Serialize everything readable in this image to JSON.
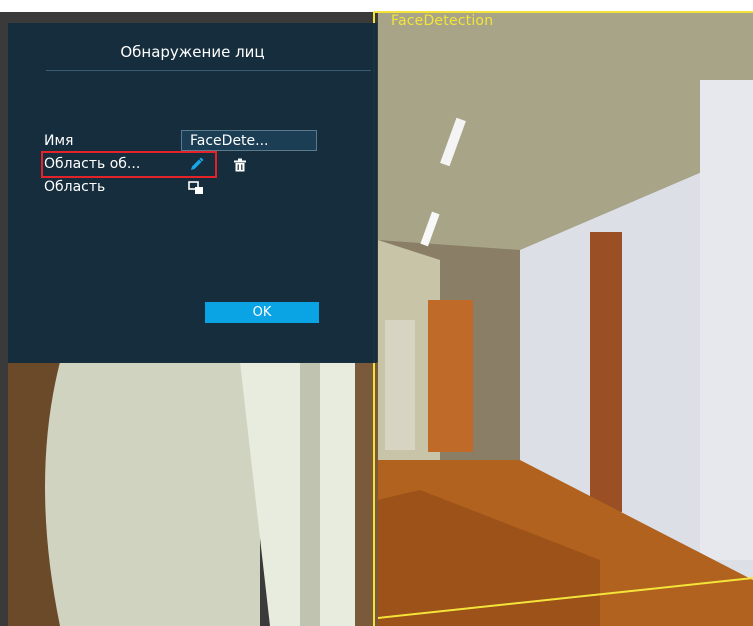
{
  "dialog": {
    "title": "Обнаружение лиц",
    "name_label": "Имя",
    "name_value": "FaceDete...",
    "detection_area_label": "Область об...",
    "area_label": "Область",
    "ok_label": "OK"
  },
  "overlay": {
    "zone_label": "FaceDetection"
  },
  "colors": {
    "dialog_bg": "#142c3c",
    "accent": "#0aa3e4",
    "highlight": "#e3222a",
    "zone_outline": "#f4e43a"
  },
  "icons": {
    "edit": "pencil-icon",
    "delete": "trash-icon",
    "area": "area-select-icon"
  }
}
